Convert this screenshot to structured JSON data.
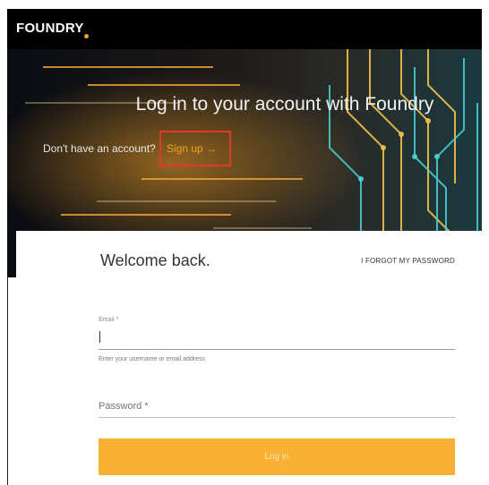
{
  "brand": {
    "logo_text": "FOUNDRY",
    "accent": "#f4a31a"
  },
  "hero": {
    "title": "Log in to your account with Foundry",
    "signup_prompt": "Don't have an account?",
    "signup_link": "Sign up →"
  },
  "form": {
    "heading": "Welcome back.",
    "forgot_password": "I FORGOT MY PASSWORD",
    "email_label": "Email *",
    "email_help": "Enter your username or email address",
    "password_placeholder": "Password *",
    "login_button": "Log in"
  }
}
